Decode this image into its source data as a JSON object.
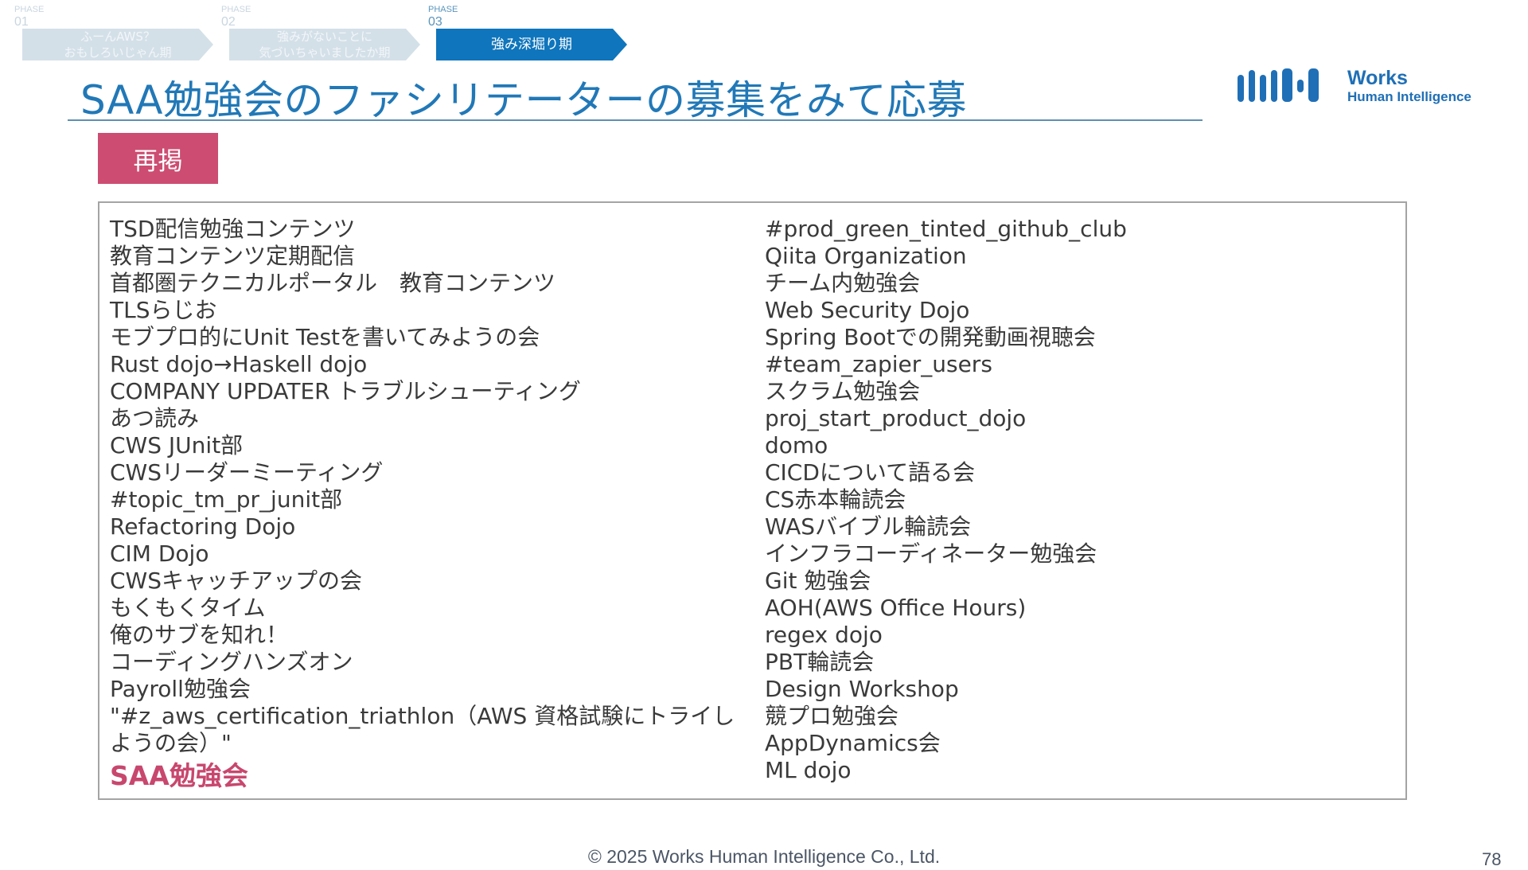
{
  "phases": [
    {
      "kicker": "PHASE",
      "number": "01",
      "label": "ふーんAWS？\nおもしろいじゃん期",
      "state": "inactive"
    },
    {
      "kicker": "PHASE",
      "number": "02",
      "label": "強みがないことに\n気づいちゃいましたか期",
      "state": "inactive"
    },
    {
      "kicker": "PHASE",
      "number": "03",
      "label": "強み深堀り期",
      "state": "active"
    }
  ],
  "title": "SAA勉強会のファシリテーターの募集をみて応募",
  "logo": {
    "line1": "Works",
    "line2": "Human Intelligence",
    "color": "#1f6fb6"
  },
  "badge": "再掲",
  "left_column": [
    "TSD配信勉強コンテンツ",
    "教育コンテンツ定期配信",
    "首都圏テクニカルポータル　教育コンテンツ",
    "TLSらじお",
    "モブプロ的にUnit Testを書いてみようの会",
    "Rust dojo→Haskell dojo",
    "COMPANY UPDATER トラブルシューティング",
    "あつ読み",
    "CWS JUnit部",
    "CWSリーダーミーティング",
    "#topic_tm_pr_junit部",
    "Refactoring Dojo",
    "CIM Dojo",
    "CWSキャッチアップの会",
    "もくもくタイム",
    "俺のサブを知れ！",
    "コーディングハンズオン",
    "Payroll勉強会",
    "\"#z_aws_certification_triathlon（AWS 資格試験にトライしようの会）\""
  ],
  "highlight_item": "SAA勉強会",
  "right_column": [
    "#prod_green_tinted_github_club",
    "Qiita Organization",
    "チーム内勉強会",
    "Web Security Dojo",
    "Spring Bootでの開発動画視聴会",
    "#team_zapier_users",
    "スクラム勉強会",
    "proj_start_product_dojo",
    "domo",
    "CICDについて語る会",
    "CS赤本輪読会",
    "WASバイブル輪読会",
    "インフラコーディネーター勉強会",
    "Git 勉強会",
    "AOH(AWS Office Hours)",
    "regex dojo",
    "PBT輪読会",
    "Design Workshop",
    "競プロ勉強会",
    "AppDynamics会",
    "ML dojo"
  ],
  "footer": "© 2025 Works Human Intelligence Co., Ltd.",
  "page_number": "78",
  "colors": {
    "accent": "#2178b7",
    "phase_active": "#0f75bc",
    "phase_inactive": "#d4e0e8",
    "badge": "#cd4c71",
    "highlight": "#c8476e"
  }
}
